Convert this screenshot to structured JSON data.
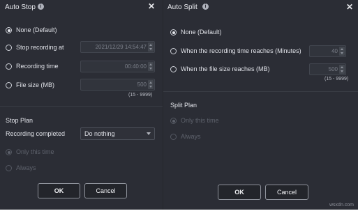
{
  "watermark": "wsxdn.com",
  "auto_stop": {
    "title": "Auto Stop",
    "options": {
      "none": "None (Default)",
      "stop_at": "Stop recording at",
      "recording_time": "Recording time",
      "file_size": "File size (MB)"
    },
    "values": {
      "stop_at": "2021/12/29 14:54:47",
      "recording_time": "00:40:00",
      "file_size": "500"
    },
    "file_size_range": "(15 - 9999)",
    "stop_plan": {
      "heading": "Stop Plan",
      "completed_label": "Recording completed",
      "completed_value": "Do nothing",
      "only_this_time": "Only this time",
      "always": "Always"
    },
    "ok": "OK",
    "cancel": "Cancel"
  },
  "auto_split": {
    "title": "Auto Split",
    "options": {
      "none": "None (Default)",
      "time": "When the recording time reaches (Minutes)",
      "size": "When the file size reaches (MB)"
    },
    "values": {
      "time": "40",
      "size": "500"
    },
    "size_range": "(15 - 9999)",
    "split_plan": {
      "heading": "Split Plan",
      "only_this_time": "Only this time",
      "always": "Always"
    },
    "ok": "OK",
    "cancel": "Cancel"
  }
}
